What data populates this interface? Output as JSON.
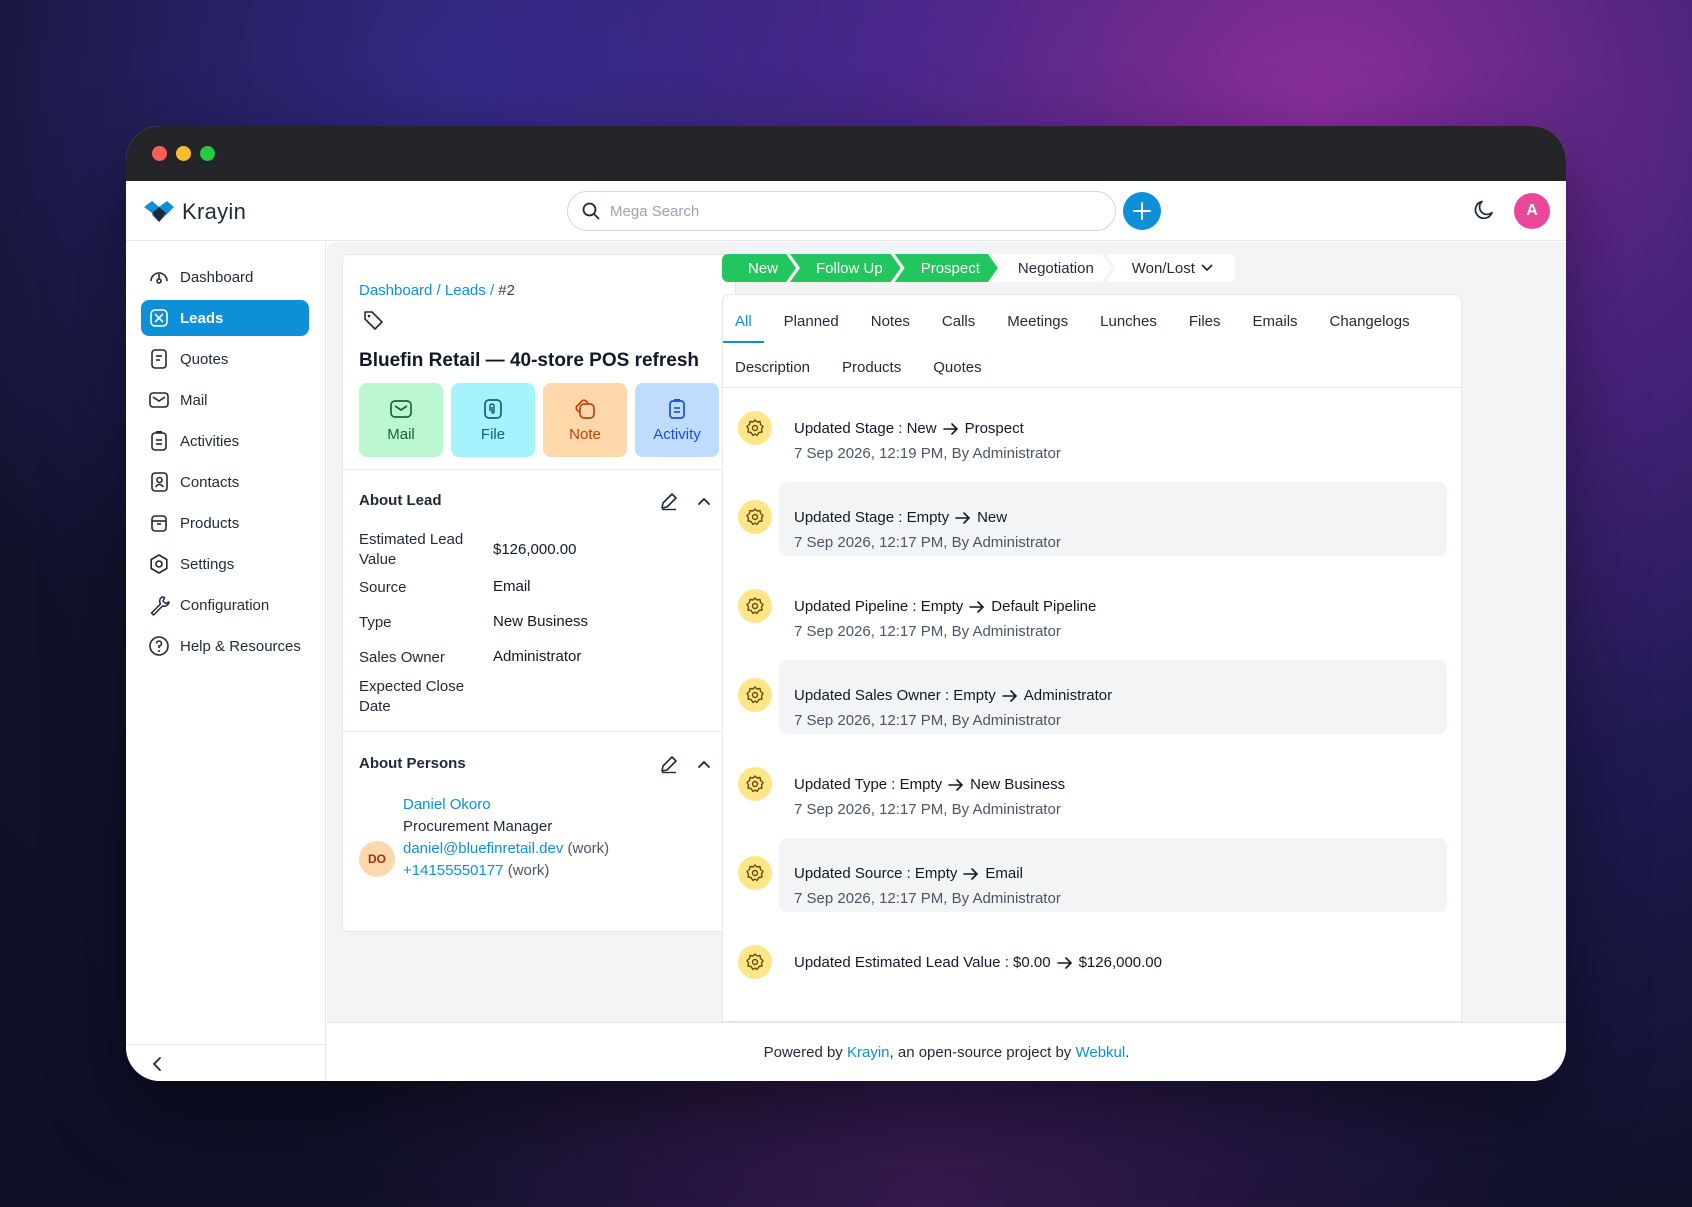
{
  "brand": {
    "name": "Krayin",
    "accent": "#0e90d9"
  },
  "search": {
    "placeholder": "Mega Search"
  },
  "user": {
    "avatar_initial": "A"
  },
  "sidebar": {
    "items": [
      {
        "label": "Dashboard",
        "icon": "dashboard-icon"
      },
      {
        "label": "Leads",
        "icon": "leads-icon",
        "active": true
      },
      {
        "label": "Quotes",
        "icon": "quotes-icon"
      },
      {
        "label": "Mail",
        "icon": "mail-icon"
      },
      {
        "label": "Activities",
        "icon": "activities-icon"
      },
      {
        "label": "Contacts",
        "icon": "contacts-icon"
      },
      {
        "label": "Products",
        "icon": "products-icon"
      },
      {
        "label": "Settings",
        "icon": "settings-icon"
      },
      {
        "label": "Configuration",
        "icon": "configuration-icon"
      },
      {
        "label": "Help & Resources",
        "icon": "help-icon"
      }
    ]
  },
  "breadcrumb": {
    "dashboard": "Dashboard",
    "sep1": " / ",
    "leads": "Leads",
    "sep2": " / ",
    "current": "#2"
  },
  "lead": {
    "title": "Bluefin Retail — 40-store POS refresh",
    "actions": {
      "mail": "Mail",
      "file": "File",
      "note": "Note",
      "activity": "Activity"
    }
  },
  "about_lead": {
    "title": "About Lead",
    "fields": [
      {
        "label": "Estimated Lead Value",
        "value": "$126,000.00"
      },
      {
        "label": "Source",
        "value": "Email"
      },
      {
        "label": "Type",
        "value": "New Business"
      },
      {
        "label": "Sales Owner",
        "value": "Administrator"
      },
      {
        "label": "Expected Close Date",
        "value": ""
      }
    ]
  },
  "about_persons": {
    "title": "About Persons",
    "person": {
      "initials": "DO",
      "name": "Daniel Okoro",
      "job": "Procurement Manager",
      "email": "daniel@bluefinretail.dev",
      "email_tag": " (work)",
      "phone": "+14155550177",
      "phone_tag": " (work)"
    }
  },
  "stages": {
    "items": [
      "New",
      "Follow Up",
      "Prospect",
      "Negotiation",
      "Won/Lost"
    ],
    "done_count": 3,
    "done_color": "#22c55e"
  },
  "tabs": {
    "row1": [
      "All",
      "Planned",
      "Notes",
      "Calls",
      "Meetings",
      "Lunches",
      "Files",
      "Emails",
      "Changelogs"
    ],
    "row2": [
      "Description",
      "Products",
      "Quotes"
    ],
    "active": "All"
  },
  "activities": [
    {
      "field": "Updated Stage : New",
      "to": "Prospect",
      "meta": "7 Sep 2026, 12:19 PM, By Administrator"
    },
    {
      "field": "Updated Stage : Empty",
      "to": "New",
      "meta": "7 Sep 2026, 12:17 PM, By Administrator"
    },
    {
      "field": "Updated Pipeline : Empty",
      "to": "Default Pipeline",
      "meta": "7 Sep 2026, 12:17 PM, By Administrator"
    },
    {
      "field": "Updated Sales Owner : Empty",
      "to": "Administrator",
      "meta": "7 Sep 2026, 12:17 PM, By Administrator"
    },
    {
      "field": "Updated Type : Empty",
      "to": "New Business",
      "meta": "7 Sep 2026, 12:17 PM, By Administrator"
    },
    {
      "field": "Updated Source : Empty",
      "to": "Email",
      "meta": "7 Sep 2026, 12:17 PM, By Administrator"
    },
    {
      "field": "Updated Estimated Lead Value : $0.00",
      "to": "$126,000.00",
      "meta": ""
    }
  ],
  "footer": {
    "prefix": "Powered by ",
    "krayin": "Krayin",
    "middle": ", an open-source project by ",
    "webkul": "Webkul",
    "suffix": "."
  }
}
